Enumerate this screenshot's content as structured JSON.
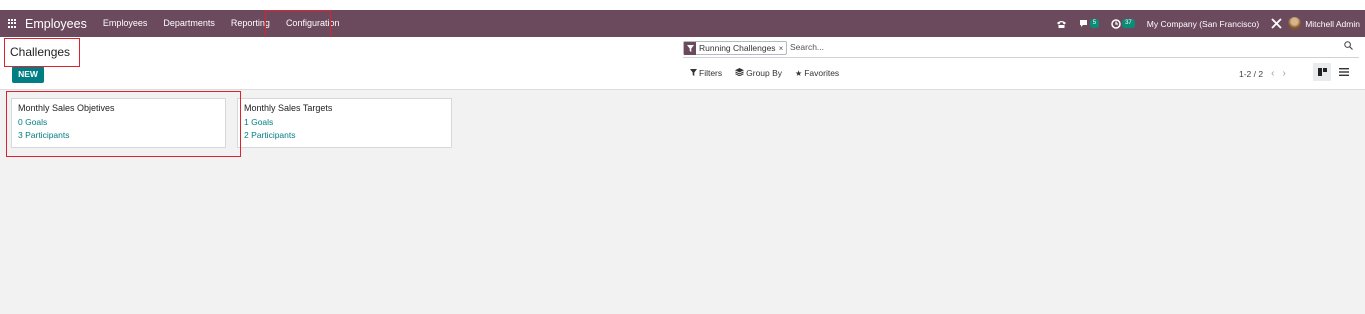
{
  "navbar": {
    "app_name": "Employees",
    "menu": [
      "Employees",
      "Departments",
      "Reporting",
      "Configuration"
    ],
    "messages_count": "5",
    "activities_count": "37",
    "company": "My Company (San Francisco)",
    "user": "Mitchell Admin"
  },
  "control_panel": {
    "title": "Challenges",
    "new_button": "NEW",
    "facet": "Running Challenges",
    "search_placeholder": "Search...",
    "filters": "Filters",
    "group_by": "Group By",
    "favorites": "Favorites",
    "pager": "1-2 / 2"
  },
  "cards": [
    {
      "title": "Monthly Sales Objetives",
      "goals": "0 Goals",
      "participants": "3 Participants"
    },
    {
      "title": "Monthly Sales Targets",
      "goals": "1 Goals",
      "participants": "2 Participants"
    }
  ],
  "colors": {
    "navbar": "#6c4a5e",
    "primary": "#017e84",
    "highlight": "#d9232e"
  }
}
